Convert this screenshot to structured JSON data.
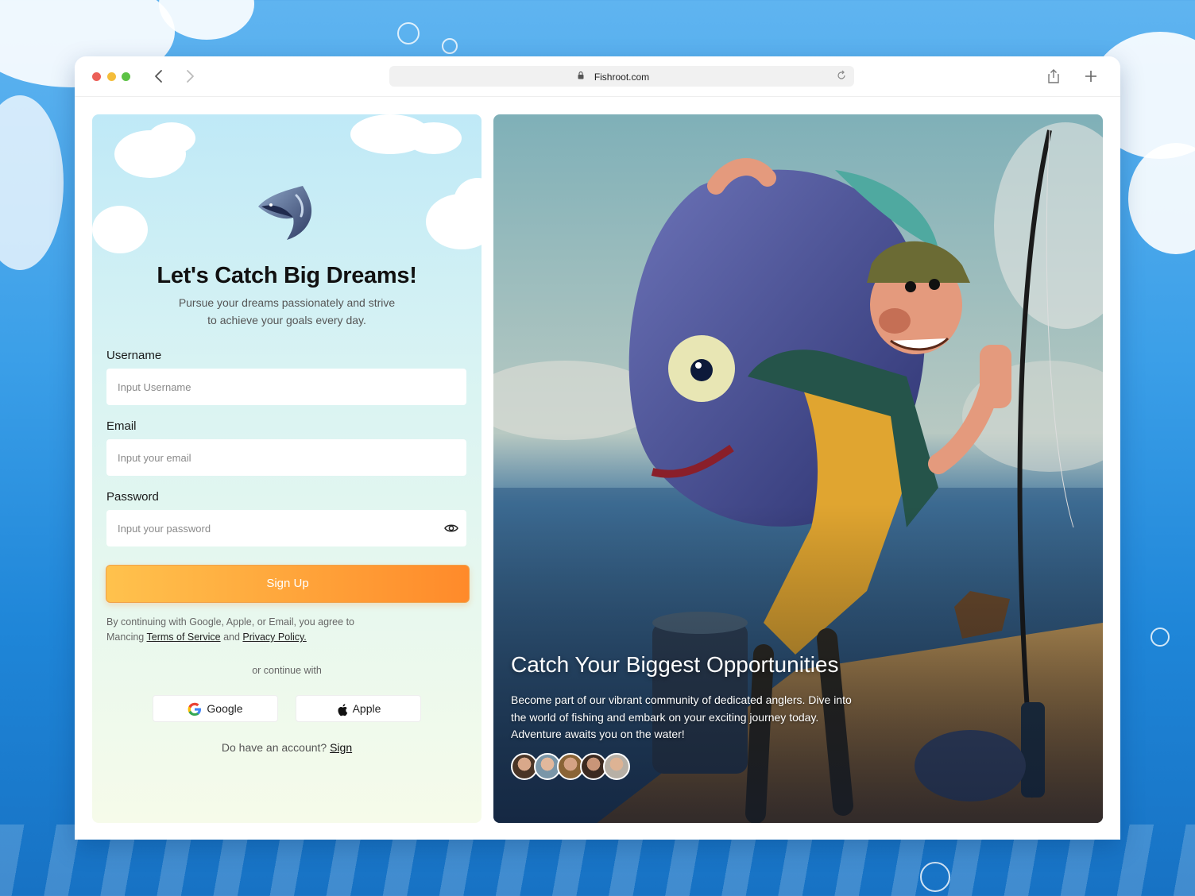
{
  "browser": {
    "url": "Fishroot.com",
    "icons": {
      "back": "chevron-left-icon",
      "forward": "chevron-right-icon",
      "lock": "lock-icon",
      "reload": "reload-icon",
      "share": "share-icon",
      "new_tab": "plus-icon"
    },
    "traffic_lights": [
      "#ec5f57",
      "#f4bd3a",
      "#5cc245"
    ]
  },
  "signup": {
    "heading": "Let's Catch Big Dreams!",
    "subtitle_line1": "Pursue your dreams passionately and strive",
    "subtitle_line2": "to achieve your goals every day.",
    "username": {
      "label": "Username",
      "placeholder": "Input Username",
      "value": ""
    },
    "email": {
      "label": "Email",
      "placeholder": "Input your email",
      "value": ""
    },
    "password": {
      "label": "Password",
      "placeholder": "Input your password",
      "value": ""
    },
    "submit_label": "Sign Up",
    "terms": {
      "prefix": "By continuing with Google, Apple, or Email, you agree to Mancing",
      "tos": "Terms of Service",
      "and": "and",
      "privacy": "Privacy Policy."
    },
    "or_continue": "or continue with",
    "google_label": "Google",
    "apple_label": "Apple",
    "have_account": "Do have an account?",
    "sign_link": "Sign"
  },
  "hero": {
    "title": "Catch Your Biggest Opportunities",
    "text": "Become part of our vibrant community of dedicated anglers. Dive into the world of fishing and embark on your exciting journey today. Adventure awaits you on the water!",
    "avatar_count": 5
  },
  "colors": {
    "accent_start": "#ffc24d",
    "accent_end": "#ff8a2a"
  }
}
